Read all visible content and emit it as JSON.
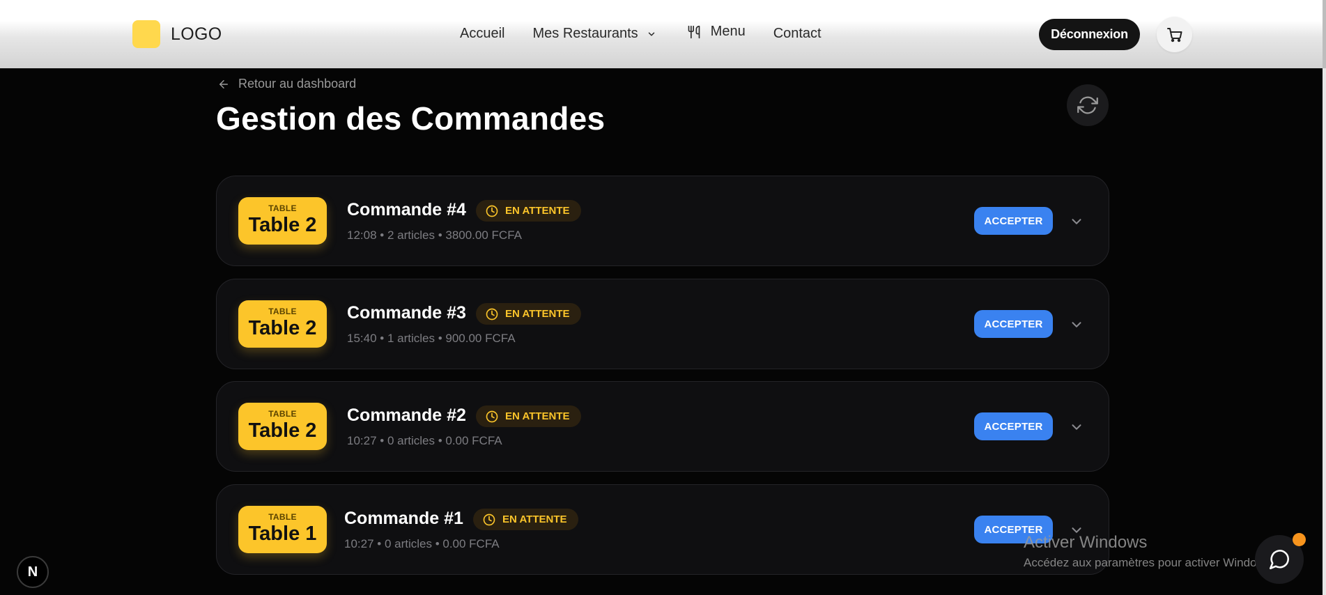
{
  "header": {
    "logo_text": "LOGO",
    "nav": {
      "home": "Accueil",
      "restaurants": "Mes Restaurants",
      "menu": "Menu",
      "contact": "Contact"
    },
    "logout_label": "Déconnexion"
  },
  "main": {
    "back_label": "Retour au dashboard",
    "title": "Gestion des Commandes"
  },
  "orders": [
    {
      "badge_small": "TABLE",
      "table": "Table 2",
      "title": "Commande #4",
      "status": "EN ATTENTE",
      "meta": "12:08 • 2 articles • 3800.00 FCFA",
      "action": "ACCEPTER"
    },
    {
      "badge_small": "TABLE",
      "table": "Table 2",
      "title": "Commande #3",
      "status": "EN ATTENTE",
      "meta": "15:40 • 1 articles • 900.00 FCFA",
      "action": "ACCEPTER"
    },
    {
      "badge_small": "TABLE",
      "table": "Table 2",
      "title": "Commande #2",
      "status": "EN ATTENTE",
      "meta": "10:27 • 0 articles • 0.00 FCFA",
      "action": "ACCEPTER"
    },
    {
      "badge_small": "TABLE",
      "table": "Table 1",
      "title": "Commande #1",
      "status": "EN ATTENTE",
      "meta": "10:27 • 0 articles • 0.00 FCFA",
      "action": "ACCEPTER"
    }
  ],
  "overlay": {
    "watermark_title": "Activer Windows",
    "watermark_subtitle": "Accédez aux paramètres pour activer Windows.",
    "next_badge": "N"
  },
  "colors": {
    "accent_yellow": "#fcc52a",
    "accent_blue": "#3a82f0",
    "background": "#050505",
    "card": "#0f0f11"
  },
  "icons": [
    "arrow-left-icon",
    "refresh-icon",
    "chevron-down-icon",
    "fork-knife-icon",
    "cart-icon",
    "clock-icon",
    "chat-icon"
  ]
}
